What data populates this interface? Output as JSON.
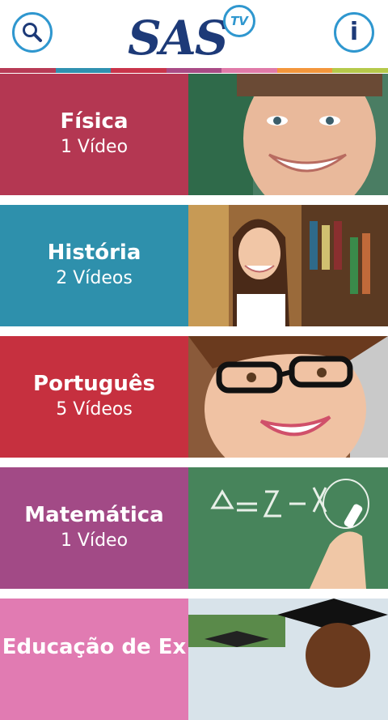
{
  "header": {
    "logo_text": "SAS",
    "logo_badge": "TV",
    "search_icon": "search-icon",
    "info_icon": "info-icon",
    "info_glyph": "i",
    "accent": "#2f97cf",
    "brand": "#1d3a78"
  },
  "colorbar": [
    "#b83a55",
    "#2f91b0",
    "#c9344a",
    "#a94b86",
    "#e07aa8",
    "#f3963c",
    "#b5c94a"
  ],
  "subjects": [
    {
      "title": "Física",
      "count": "1 Vídeo",
      "color": "#b43752"
    },
    {
      "title": "História",
      "count": "2 Vídeos",
      "color": "#2e90ac"
    },
    {
      "title": "Português",
      "count": "5 Vídeos",
      "color": "#c6303f"
    },
    {
      "title": "Matemática",
      "count": "1 Vídeo",
      "color": "#a24a86"
    },
    {
      "title": "Educação de Ex",
      "count": "",
      "color": "#e17bb2"
    }
  ]
}
